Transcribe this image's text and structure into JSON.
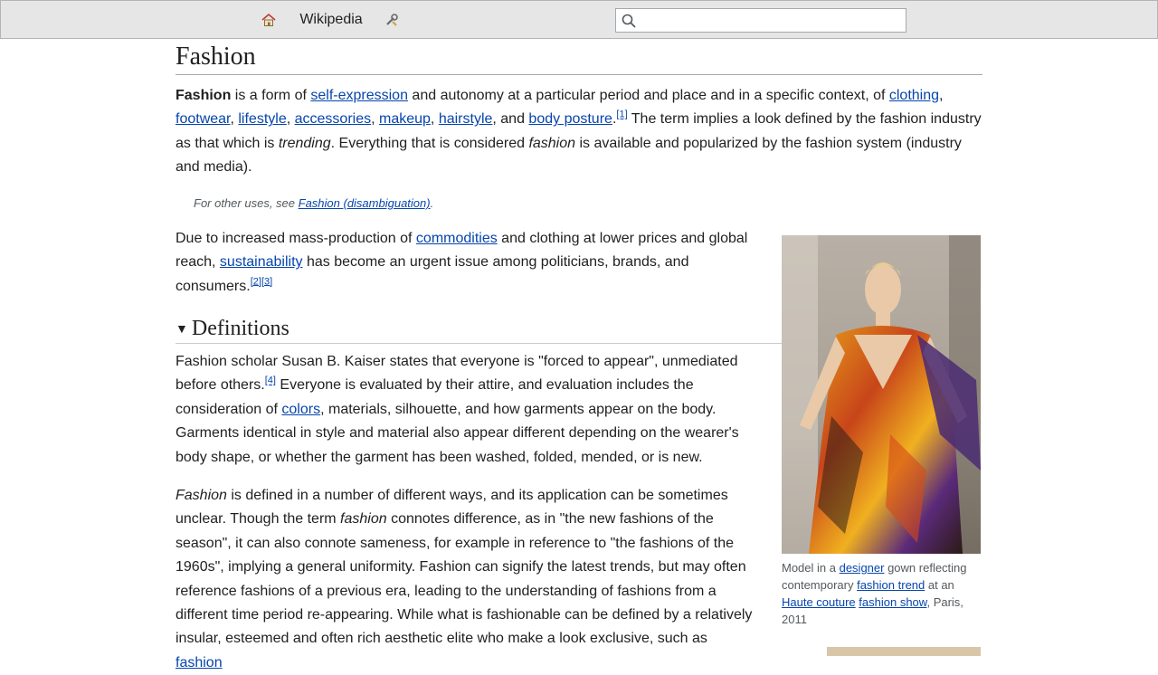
{
  "toolbar": {
    "wikipedia_label": "Wikipedia",
    "search_placeholder": "",
    "home_icon": "home-icon",
    "tools_icon": "tools-icon",
    "search_icon": "search-icon"
  },
  "article": {
    "title": "Fashion",
    "lead": {
      "bold": "Fashion",
      "t1": " is a form of ",
      "link_self_expression": "self-expression",
      "t2": " and autonomy at a particular period and place and in a specific context, of ",
      "link_clothing": "clothing",
      "t3": ", ",
      "link_footwear": "footwear",
      "t4": ", ",
      "link_lifestyle": "lifestyle",
      "t5": ", ",
      "link_accessories": "accessories",
      "t6": ", ",
      "link_makeup": "makeup",
      "t7": ", ",
      "link_hairstyle": "hairstyle",
      "t8": ", and ",
      "link_body_posture": "body posture",
      "t9": ".",
      "ref1": "[1]",
      "t10": " The term implies a look defined by the fashion industry as that which is ",
      "em_trending": "trending",
      "t11": ". Everything that is considered ",
      "em_fashion": "fashion",
      "t12": " is available and popularized by the fashion system (industry and media)."
    },
    "hatnote": {
      "text": "For other uses, see ",
      "link": "Fashion (disambiguation)",
      "end": "."
    },
    "p2": {
      "t1": "Due to increased mass-production of ",
      "link_commodities": "commodities",
      "t2": " and clothing at lower prices and global reach, ",
      "link_sustainability": "sustainability",
      "t3": " has become an urgent issue among politicians, brands, and consumers.",
      "ref2": "[2]",
      "ref3": "[3]"
    },
    "section_definitions": "Definitions",
    "p3": {
      "t1": "Fashion scholar Susan B. Kaiser states that everyone is \"forced to appear\", unmediated before others.",
      "ref4": "[4]",
      "t2": " Everyone is evaluated by their attire, and evaluation includes the consideration of ",
      "link_colors": "colors",
      "t3": ", materials, silhouette, and how garments appear on the body. Garments identical in style and material also appear different depending on the wearer's body shape, or whether the garment has been washed, folded, mended, or is new."
    },
    "p4": {
      "em1": "Fashion",
      "t1": " is defined in a number of different ways, and its application can be sometimes unclear. Though the term ",
      "em2": "fashion",
      "t2": " connotes difference, as in \"the new fashions of the season\", it can also connote sameness, for example in reference to \"the fashions of the 1960s\", implying a general uniformity. Fashion can signify the latest trends, but may often reference fashions of a previous era, leading to the understanding of fashions from a different time period re-appearing. While what is fashionable can be defined by a relatively insular, esteemed and often rich aesthetic elite who make a look exclusive, such as ",
      "link_fashion": "fashion"
    },
    "figure": {
      "caption_t1": "Model in a ",
      "link_designer": "designer",
      "caption_t2": " gown reflecting contemporary ",
      "link_fashion_trend": "fashion trend",
      "caption_t3": " at an ",
      "link_haute_couture": "Haute couture",
      "caption_t4": " ",
      "link_fashion_show": "fashion show",
      "caption_t5": ", Paris, 2011"
    }
  }
}
